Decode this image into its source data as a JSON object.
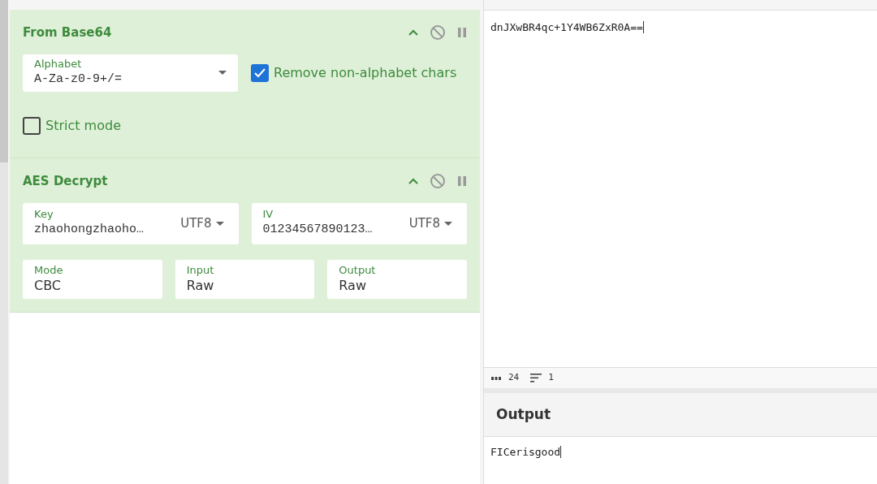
{
  "recipe": [
    {
      "title": "From Base64",
      "ingredients": [
        {
          "kind": "select",
          "label": "Alphabet",
          "value": "A-Za-z0-9+/="
        },
        {
          "kind": "checkbox",
          "label": "Remove non-alphabet chars",
          "checked": true
        },
        {
          "kind": "checkbox",
          "label": "Strict mode",
          "checked": false
        }
      ]
    },
    {
      "title": "AES Decrypt",
      "ingredients": [
        {
          "kind": "toggle",
          "label": "Key",
          "value": "zhaohongzhaoho…",
          "encoding": "UTF8"
        },
        {
          "kind": "toggle",
          "label": "IV",
          "value": "01234567890123…",
          "encoding": "UTF8"
        },
        {
          "kind": "option",
          "label": "Mode",
          "value": "CBC"
        },
        {
          "kind": "option",
          "label": "Input",
          "value": "Raw"
        },
        {
          "kind": "option",
          "label": "Output",
          "value": "Raw"
        }
      ]
    }
  ],
  "input": {
    "text": "dnJXwBR4qc+1Y4WB6ZxR0A==",
    "chars": "24",
    "lines": "1"
  },
  "output": {
    "title": "Output",
    "text": "FICerisgood"
  }
}
